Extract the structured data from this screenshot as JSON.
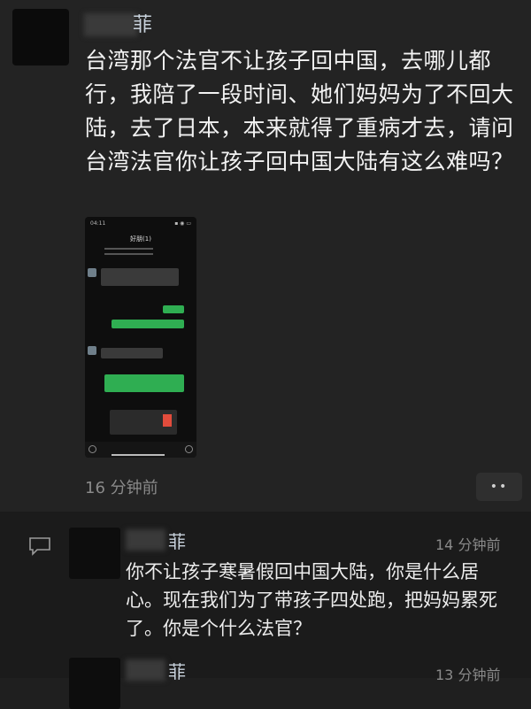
{
  "post": {
    "author": "菲",
    "text": "台湾那个法官不让孩子回中国，去哪儿都行，我陪了一段时间、她们妈妈为了不回大陆，去了日本，本来就得了重病才去，请问台湾法官你让孩子回中国大陆有这么难吗？",
    "time": "16 分钟前",
    "more_label": "••"
  },
  "screenshot": {
    "status_time": "04:11",
    "status_icons": "▪ ◉ ▭",
    "chat_title": "好朋(1)"
  },
  "comments": [
    {
      "author": "菲",
      "time": "14 分钟前",
      "text": "你不让孩子寒暑假回中国大陆，你是什么居心。现在我们为了带孩子四处跑，把妈妈累死了。你是个什么法官？"
    },
    {
      "author": "菲",
      "time": "13 分钟前"
    }
  ],
  "colors": {
    "background": "#1f1f1f",
    "green_bubble": "#2fae52",
    "time_gray": "#8a8a8a"
  }
}
